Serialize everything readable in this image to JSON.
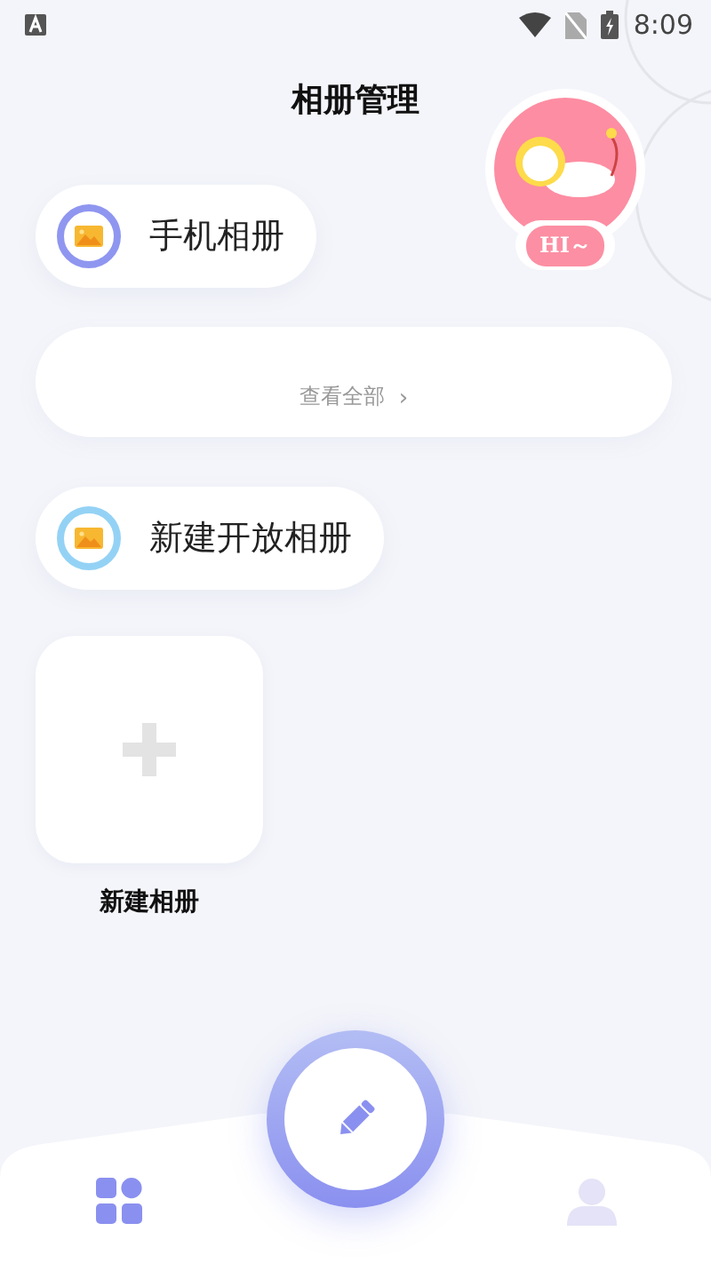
{
  "status_bar": {
    "time": "8:09"
  },
  "header": {
    "title": "相册管理",
    "avatar_badge": "HI～"
  },
  "albums": [
    {
      "label": "手机相册",
      "color": "#8f96f0"
    },
    {
      "label": "新建开放相册",
      "color": "#94d2f5"
    }
  ],
  "all_card": {
    "link": "查看全部",
    "chevron": "›"
  },
  "new_album": {
    "label": "新建相册"
  },
  "nav": [
    {
      "kind": "grid",
      "selected": true
    },
    {
      "kind": "edit",
      "selected": false
    },
    {
      "kind": "profile",
      "selected": false
    }
  ]
}
